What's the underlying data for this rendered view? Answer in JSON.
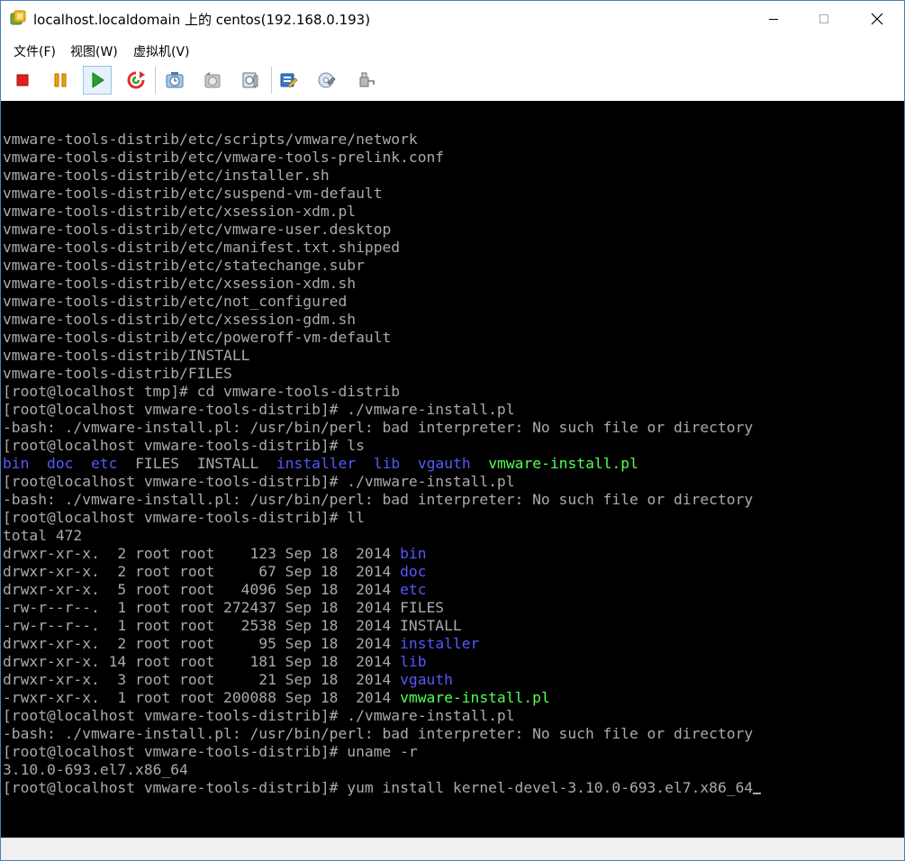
{
  "window": {
    "title": "localhost.localdomain 上的 centos(192.168.0.193)"
  },
  "menu": {
    "items": [
      "文件(F)",
      "视图(W)",
      "虚拟机(V)"
    ]
  },
  "toolbar": {
    "buttons": [
      {
        "icon": "stop-icon",
        "color": "#e02020"
      },
      {
        "icon": "pause-icon",
        "color": "#f0a000"
      },
      {
        "icon": "play-icon",
        "color": "#28a028"
      },
      {
        "icon": "reset-icon",
        "color": "#e03030"
      },
      {
        "icon": "snapshot-icon"
      },
      {
        "icon": "revert-snapshot-icon"
      },
      {
        "icon": "manage-snapshots-icon"
      },
      {
        "icon": "edit-settings-icon"
      },
      {
        "icon": "connect-cd-icon"
      },
      {
        "icon": "connect-device-icon"
      }
    ]
  },
  "colors": {
    "console_bg": "#000000",
    "console_text": "#aaaaaa",
    "dir_blue": "#5757ff",
    "exec_green": "#55ff55"
  },
  "terminal": {
    "lines": [
      [
        {
          "t": "vmware-tools-distrib/etc/scripts/vmware/network"
        }
      ],
      [
        {
          "t": "vmware-tools-distrib/etc/vmware-tools-prelink.conf"
        }
      ],
      [
        {
          "t": "vmware-tools-distrib/etc/installer.sh"
        }
      ],
      [
        {
          "t": "vmware-tools-distrib/etc/suspend-vm-default"
        }
      ],
      [
        {
          "t": "vmware-tools-distrib/etc/xsession-xdm.pl"
        }
      ],
      [
        {
          "t": "vmware-tools-distrib/etc/vmware-user.desktop"
        }
      ],
      [
        {
          "t": "vmware-tools-distrib/etc/manifest.txt.shipped"
        }
      ],
      [
        {
          "t": "vmware-tools-distrib/etc/statechange.subr"
        }
      ],
      [
        {
          "t": "vmware-tools-distrib/etc/xsession-xdm.sh"
        }
      ],
      [
        {
          "t": "vmware-tools-distrib/etc/not_configured"
        }
      ],
      [
        {
          "t": "vmware-tools-distrib/etc/xsession-gdm.sh"
        }
      ],
      [
        {
          "t": "vmware-tools-distrib/etc/poweroff-vm-default"
        }
      ],
      [
        {
          "t": "vmware-tools-distrib/INSTALL"
        }
      ],
      [
        {
          "t": "vmware-tools-distrib/FILES"
        }
      ],
      [
        {
          "t": "[root@localhost tmp]# cd vmware-tools-distrib"
        }
      ],
      [
        {
          "t": "[root@localhost vmware-tools-distrib]# ./vmware-install.pl"
        }
      ],
      [
        {
          "t": "-bash: ./vmware-install.pl: /usr/bin/perl: bad interpreter: No such file or directory"
        }
      ],
      [
        {
          "t": "[root@localhost vmware-tools-distrib]# ls"
        }
      ],
      [
        {
          "t": "bin",
          "c": "blue"
        },
        {
          "t": "  "
        },
        {
          "t": "doc",
          "c": "blue"
        },
        {
          "t": "  "
        },
        {
          "t": "etc",
          "c": "blue"
        },
        {
          "t": "  FILES  INSTALL  "
        },
        {
          "t": "installer",
          "c": "blue"
        },
        {
          "t": "  "
        },
        {
          "t": "lib",
          "c": "blue"
        },
        {
          "t": "  "
        },
        {
          "t": "vgauth",
          "c": "blue"
        },
        {
          "t": "  "
        },
        {
          "t": "vmware-install.pl",
          "c": "green"
        }
      ],
      [
        {
          "t": "[root@localhost vmware-tools-distrib]# ./vmware-install.pl"
        }
      ],
      [
        {
          "t": "-bash: ./vmware-install.pl: /usr/bin/perl: bad interpreter: No such file or directory"
        }
      ],
      [
        {
          "t": "[root@localhost vmware-tools-distrib]# ll"
        }
      ],
      [
        {
          "t": "total 472"
        }
      ],
      [
        {
          "t": "drwxr-xr-x.  2 root root    123 Sep 18  2014 "
        },
        {
          "t": "bin",
          "c": "blue"
        }
      ],
      [
        {
          "t": "drwxr-xr-x.  2 root root     67 Sep 18  2014 "
        },
        {
          "t": "doc",
          "c": "blue"
        }
      ],
      [
        {
          "t": "drwxr-xr-x.  5 root root   4096 Sep 18  2014 "
        },
        {
          "t": "etc",
          "c": "blue"
        }
      ],
      [
        {
          "t": "-rw-r--r--.  1 root root 272437 Sep 18  2014 FILES"
        }
      ],
      [
        {
          "t": "-rw-r--r--.  1 root root   2538 Sep 18  2014 INSTALL"
        }
      ],
      [
        {
          "t": "drwxr-xr-x.  2 root root     95 Sep 18  2014 "
        },
        {
          "t": "installer",
          "c": "blue"
        }
      ],
      [
        {
          "t": "drwxr-xr-x. 14 root root    181 Sep 18  2014 "
        },
        {
          "t": "lib",
          "c": "blue"
        }
      ],
      [
        {
          "t": "drwxr-xr-x.  3 root root     21 Sep 18  2014 "
        },
        {
          "t": "vgauth",
          "c": "blue"
        }
      ],
      [
        {
          "t": "-rwxr-xr-x.  1 root root 200088 Sep 18  2014 "
        },
        {
          "t": "vmware-install.pl",
          "c": "green"
        }
      ],
      [
        {
          "t": "[root@localhost vmware-tools-distrib]# ./vmware-install.pl"
        }
      ],
      [
        {
          "t": "-bash: ./vmware-install.pl: /usr/bin/perl: bad interpreter: No such file or directory"
        }
      ],
      [
        {
          "t": "[root@localhost vmware-tools-distrib]# uname -r"
        }
      ],
      [
        {
          "t": "3.10.0-693.el7.x86_64"
        }
      ],
      [
        {
          "t": "[root@localhost vmware-tools-distrib]# yum install kernel-devel-3.10.0-693.el7.x86_64"
        }
      ]
    ]
  }
}
